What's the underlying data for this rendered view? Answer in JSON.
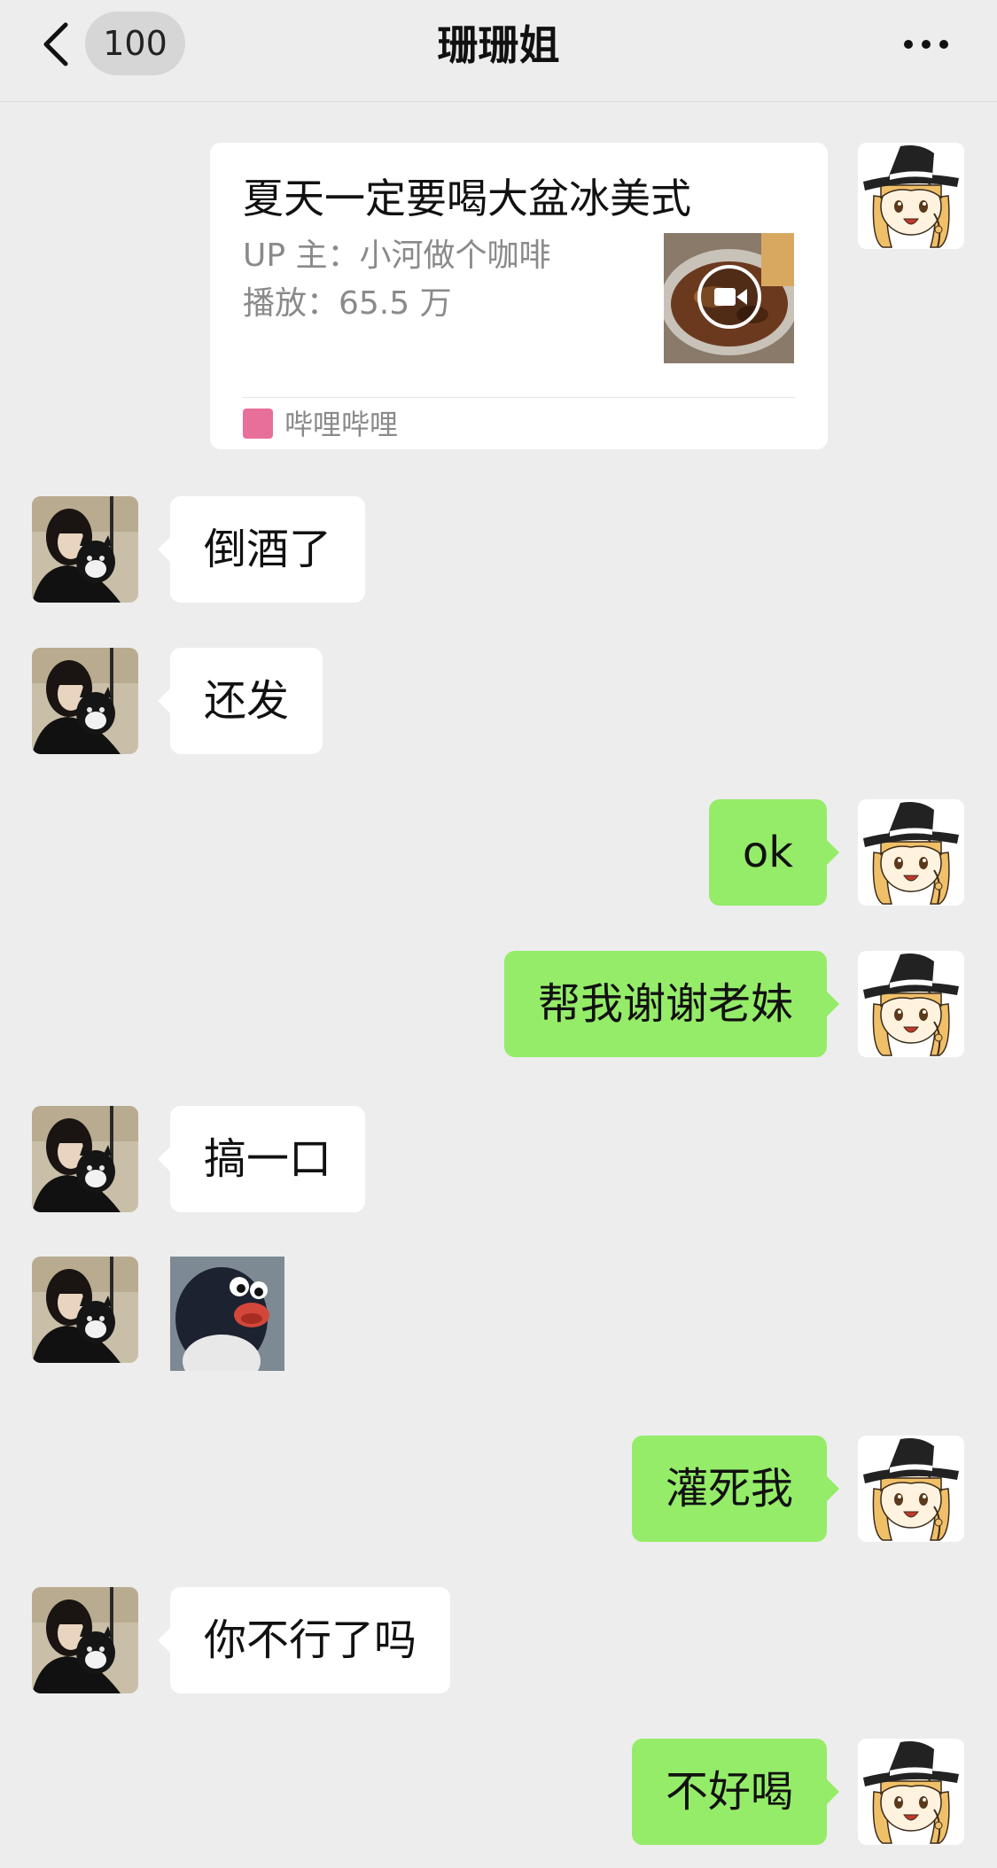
{
  "header": {
    "unread_count": "100",
    "title": "珊珊姐"
  },
  "video_card": {
    "title": "夏天一定要喝大盆冰美式",
    "uploader": "UP 主：小河做个咖啡",
    "plays": "播放：65.5 万",
    "source": "哔哩哔哩"
  },
  "messages": [
    {
      "from": "friend",
      "text": "倒酒了"
    },
    {
      "from": "friend",
      "text": "还发"
    },
    {
      "from": "me",
      "text": "ok"
    },
    {
      "from": "me",
      "text": "帮我谢谢老妹"
    },
    {
      "from": "friend",
      "text": "搞一口"
    },
    {
      "from": "friend",
      "type": "sticker",
      "icon": "penguin-sticker"
    },
    {
      "from": "me",
      "text": "灌死我"
    },
    {
      "from": "friend",
      "text": "你不行了吗"
    },
    {
      "from": "me",
      "text": "不好喝"
    }
  ],
  "colors": {
    "background": "#ededed",
    "outgoing_bubble": "#95ec69",
    "incoming_bubble": "#ffffff"
  }
}
